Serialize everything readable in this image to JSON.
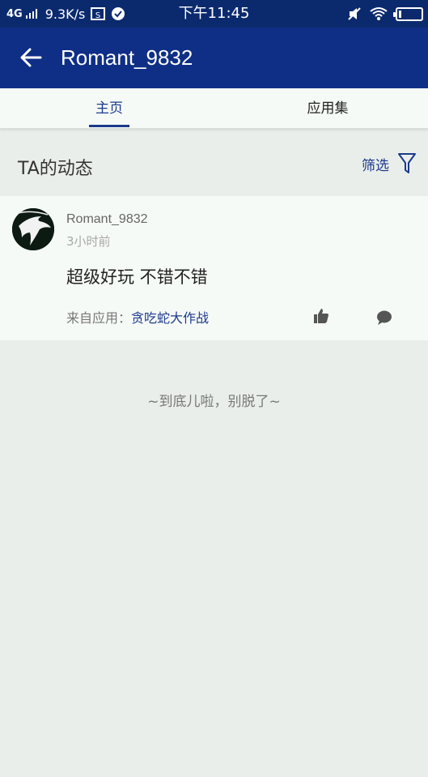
{
  "status_bar": {
    "network": "4G",
    "speed": "9.3K/s",
    "time": "下午11:45"
  },
  "app_bar": {
    "title": "Romant_9832"
  },
  "tabs": [
    {
      "label": "主页",
      "active": true
    },
    {
      "label": "应用集",
      "active": false
    }
  ],
  "section": {
    "title": "TA的动态",
    "filter_label": "筛选"
  },
  "post": {
    "username": "Romant_9832",
    "time_ago": "3小时前",
    "content": "超级好玩 不错不错",
    "source_prefix": "来自应用：",
    "source_app": "贪吃蛇大作战"
  },
  "end_message": "~到底儿啦，别脱了~",
  "colors": {
    "status_bar": "#0b2a6e",
    "app_bar": "#0f2f86",
    "accent": "#1b3a8c",
    "background": "#eaeeeb",
    "card": "#f6faf7"
  }
}
